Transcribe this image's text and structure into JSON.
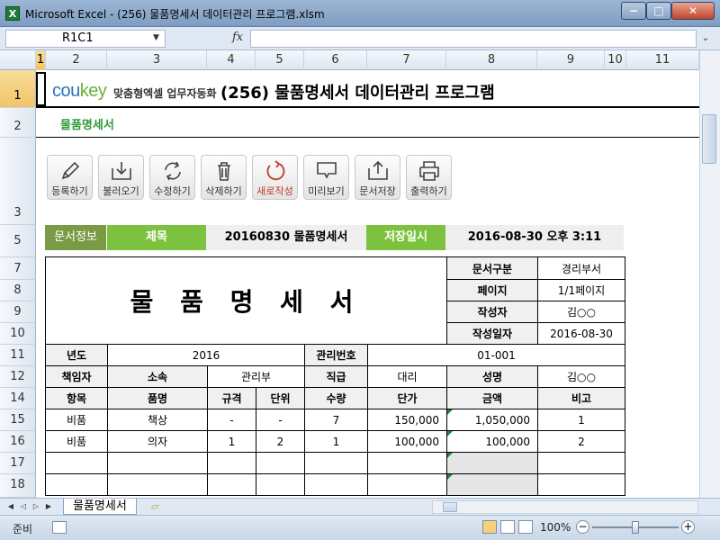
{
  "window": {
    "title": "Microsoft Excel - (256) 물품명세서 데이터관리 프로그램.xlsm",
    "app_icon": "X",
    "min": "−",
    "max": "□",
    "close": "✕"
  },
  "formula_bar": {
    "name_box": "R1C1",
    "fx": "fx",
    "formula": ""
  },
  "columns": [
    "1",
    "2",
    "3",
    "4",
    "5",
    "6",
    "7",
    "8",
    "9",
    "10",
    "11"
  ],
  "rows": [
    "1",
    "2",
    "3",
    "5",
    "7",
    "8",
    "9",
    "10",
    "11",
    "12",
    "14",
    "15",
    "16",
    "17",
    "18"
  ],
  "header": {
    "logo_main": "cou",
    "logo_accent": "key",
    "tagline": "맞춤형엑셀 업무자동화",
    "heading": "(256) 물품명세서 데이터관리 프로그램",
    "subtitle": "물품명세서"
  },
  "toolbar": [
    {
      "label": "등록하기",
      "icon": "pencil-icon"
    },
    {
      "label": "불러오기",
      "icon": "download-icon"
    },
    {
      "label": "수정하기",
      "icon": "refresh-icon"
    },
    {
      "label": "삭제하기",
      "icon": "trash-icon"
    },
    {
      "label": "새로작성",
      "icon": "new-doc-icon"
    },
    {
      "label": "미리보기",
      "icon": "monitor-icon"
    },
    {
      "label": "문서저장",
      "icon": "upload-icon"
    },
    {
      "label": "출력하기",
      "icon": "printer-icon"
    }
  ],
  "info_row": {
    "doc_info_label": "문서정보",
    "title_label": "제목",
    "title_value": "20160830 물품명세서",
    "saved_label": "저장일시",
    "saved_value": "2016-08-30  오후 3:11"
  },
  "form": {
    "big_title": "물 품 명 세 서",
    "doc_type_label": "문서구분",
    "doc_type_value": "경리부서",
    "page_label": "페이지",
    "page_value": "1/1페이지",
    "author_label": "작성자",
    "author_value": "김○○",
    "date_label": "작성일자",
    "date_value": "2016-08-30",
    "year_label": "년도",
    "year_value": "2016",
    "mgmt_no_label": "관리번호",
    "mgmt_no_value": "01-001",
    "manager_label": "책임자",
    "dept_label": "소속",
    "dept_value": "관리부",
    "rank_label": "직급",
    "rank_value": "대리",
    "name_label": "성명",
    "name_value": "김○○",
    "columns": [
      "항목",
      "품명",
      "규격",
      "단위",
      "수량",
      "단가",
      "금액",
      "비고"
    ],
    "items": [
      {
        "category": "비품",
        "name": "책상",
        "spec": "-",
        "unit": "-",
        "qty": "7",
        "price": "150,000",
        "amount": "1,050,000",
        "note": "1"
      },
      {
        "category": "비품",
        "name": "의자",
        "spec": "1",
        "unit": "2",
        "qty": "1",
        "price": "100,000",
        "amount": "100,000",
        "note": "2"
      }
    ]
  },
  "sheet_tabs": {
    "nav": [
      "◀",
      "◁",
      "▷",
      "▶"
    ],
    "active": "물품명세서"
  },
  "status": {
    "ready": "준비",
    "zoom": "100%",
    "zoom_out": "−",
    "zoom_in": "+"
  }
}
